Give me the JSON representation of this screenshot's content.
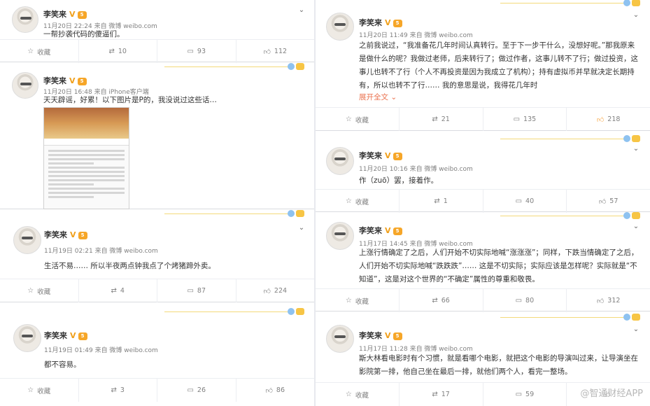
{
  "author": {
    "name": "李笑来",
    "verified_mark": "V",
    "level_badge": "5"
  },
  "action_labels": {
    "favorite": "收藏"
  },
  "left_posts": [
    {
      "time": "11月20日 22:24 来自 微博 weibo.com",
      "text": "一帮抄袭代码的傻逼们。",
      "reposts": "10",
      "comments": "93",
      "likes": "112"
    },
    {
      "time": "11月20日 16:48 来自 iPhone客户端",
      "text": "天天辟谣，好累！以下图片是P的，我没说过这些话…",
      "has_image": true
    },
    {
      "time": "11月19日 02:21 来自 微博 weibo.com",
      "text": "生活不易…… 所以半夜两点钟我点了个烤猪蹄外卖。",
      "reposts": "4",
      "comments": "87",
      "likes": "224"
    },
    {
      "time": "11月19日 01:49 来自 微博 weibo.com",
      "text": "都不容易。",
      "reposts": "3",
      "comments": "26",
      "likes": "86"
    }
  ],
  "right_posts": [
    {
      "time": "11月20日 11:49 来自 微博 weibo.com",
      "text": "之前我说过，“我准备花几年时间认真转行。至于下一步干什么，没想好呢。”那我原来是做什么的呢？我做过老师，后来转行了；做过作者，这事儿转不了行；做过投资，这事儿也转不了行（个人不再投资是因为我成立了机构）；持有虚拟币并早就决定长期持有，所以也转不了行…… 我的意思是说，我得花几年时",
      "expand": "展开全文",
      "reposts": "21",
      "comments": "135",
      "likes": "218"
    },
    {
      "time": "11月20日 10:16 来自 微博 weibo.com",
      "text": "作（zuō）罢，接着作。",
      "reposts": "1",
      "comments": "40",
      "likes": "57"
    },
    {
      "time": "11月17日 14:45 来自 微博 weibo.com",
      "text": "上涨行情确定了之后，人们开始不切实际地喊“涨涨涨”；同样，下跌当情确定了之后，人们开始不切实际地喊“跌跌跌”…… 这是不切实际；实际应该是怎样呢？实际就是“不知道”，这是对这个世界的“不确定”属性的尊重和敬畏。",
      "reposts": "66",
      "comments": "80",
      "likes": "312"
    },
    {
      "time": "11月17日 11:28 来自 微博 weibo.com",
      "text": "斯大林看电影时有个习惯，就是看哪个电影，就把这个电影的导演叫过来，让导演坐在影院第一排，他自己坐在最后一排，就他们两个人，看完一整场。",
      "reposts": "17",
      "comments": "59"
    }
  ],
  "watermark": "@智通财经APP"
}
